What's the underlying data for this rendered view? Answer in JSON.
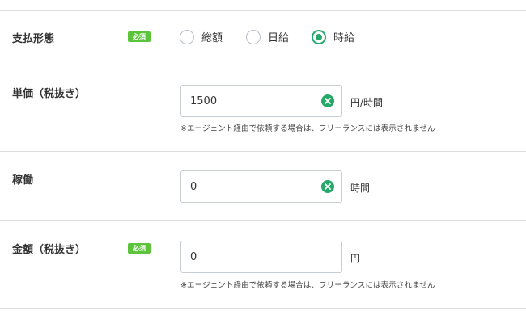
{
  "payment_type": {
    "label": "支払形態",
    "required_badge": "必須",
    "options": [
      {
        "label": "総額",
        "checked": false
      },
      {
        "label": "日給",
        "checked": false
      },
      {
        "label": "時給",
        "checked": true
      }
    ]
  },
  "unit_price": {
    "label": "単価（税抜き）",
    "value": "1500",
    "unit": "円/時間",
    "note": "※エージェント経由で依頼する場合は、フリーランスには表示されません"
  },
  "working_hours": {
    "label": "稼働",
    "value": "0",
    "unit": "時間"
  },
  "amount": {
    "label": "金額（税抜き）",
    "required_badge": "必須",
    "value": "0",
    "unit": "円",
    "note": "※エージェント経由で依頼する場合は、フリーランスには表示されません"
  },
  "colors": {
    "accent_green": "#27a86a",
    "badge_green": "#5cc43b",
    "divider": "#dcdcdc",
    "input_border": "#c8cdd2"
  },
  "icons": {
    "clear": "close-circle-icon",
    "radio": "radio-button-icon"
  }
}
